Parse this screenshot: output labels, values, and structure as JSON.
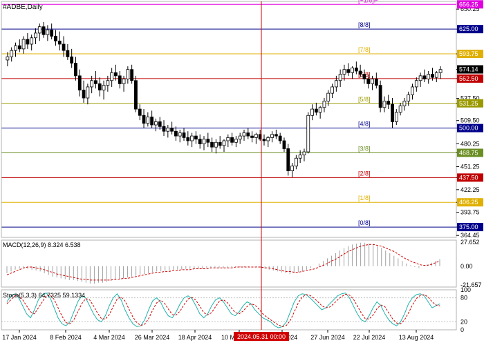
{
  "chart_data": {
    "type": "candlestick",
    "symbol_label": "#ADBE,Daily",
    "price_axis": {
      "min": 362,
      "max": 660,
      "ticks": [
        "650.25",
        "625.00",
        "593.75",
        "574.14",
        "562.50",
        "537.50",
        "531.25",
        "509.50",
        "500.00",
        "480.25",
        "468.75",
        "451.25",
        "437.50",
        "422.25",
        "406.25",
        "393.75",
        "375.00",
        "364.45"
      ]
    },
    "highlighted_prices": [
      {
        "value": "656.25",
        "color": "#e000e0",
        "text_color": "#ffffff"
      },
      {
        "value": "625.00",
        "color": "#00008b",
        "text_color": "#ffffff"
      },
      {
        "value": "593.75",
        "color": "#e0b000",
        "text_color": "#ffffff"
      },
      {
        "value": "574.14",
        "color": "#000000",
        "text_color": "#ffffff"
      },
      {
        "value": "562.50",
        "color": "#c00000",
        "text_color": "#ffffff"
      },
      {
        "value": "531.25",
        "color": "#9a9a00",
        "text_color": "#ffffff"
      },
      {
        "value": "500.00",
        "color": "#00008b",
        "text_color": "#ffffff"
      },
      {
        "value": "468.75",
        "color": "#6b8e23",
        "text_color": "#ffffff"
      },
      {
        "value": "437.50",
        "color": "#c00000",
        "text_color": "#ffffff"
      },
      {
        "value": "406.25",
        "color": "#e0b000",
        "text_color": "#ffffff"
      },
      {
        "value": "375.00",
        "color": "#00008b",
        "text_color": "#ffffff"
      }
    ],
    "murrey_levels": [
      {
        "label": "[+1/8]P",
        "value": 656.25,
        "color": "#e000e0"
      },
      {
        "label": "[8/8]",
        "value": 625.0,
        "color": "#00008b"
      },
      {
        "label": "[7/8]",
        "value": 593.75,
        "color": "#e0b000"
      },
      {
        "label": "[6/8]",
        "value": 562.5,
        "color": "#c00000"
      },
      {
        "label": "[5/8]",
        "value": 531.25,
        "color": "#9a9a00"
      },
      {
        "label": "[4/8]",
        "value": 500.0,
        "color": "#00008b"
      },
      {
        "label": "[3/8]",
        "value": 468.75,
        "color": "#6b8e23"
      },
      {
        "label": "[2/8]",
        "value": 437.5,
        "color": "#c00000"
      },
      {
        "label": "[1/8]",
        "value": 406.25,
        "color": "#e0b000"
      },
      {
        "label": "[0/8]",
        "value": 375.0,
        "color": "#00008b"
      }
    ],
    "dates": [
      "17 Jan 2024",
      "8 Feb 2024",
      "4 Mar 2024",
      "26 Mar 2024",
      "18 Apr 2024",
      "10 May 2024",
      "3 Jun 2024",
      "27 Jun 2024",
      "22 Jul 2024",
      "13 Aug 2024"
    ],
    "crosshair_date": "2024.05.31 00:00",
    "ohlc": [
      [
        586,
        596,
        578,
        590
      ],
      [
        590,
        602,
        584,
        598
      ],
      [
        598,
        608,
        590,
        604
      ],
      [
        604,
        612,
        596,
        600
      ],
      [
        600,
        616,
        594,
        612
      ],
      [
        612,
        620,
        600,
        606
      ],
      [
        606,
        618,
        598,
        614
      ],
      [
        614,
        626,
        606,
        620
      ],
      [
        620,
        632,
        610,
        628
      ],
      [
        628,
        634,
        614,
        618
      ],
      [
        618,
        630,
        610,
        624
      ],
      [
        624,
        632,
        612,
        616
      ],
      [
        616,
        624,
        604,
        610
      ],
      [
        610,
        622,
        598,
        606
      ],
      [
        606,
        616,
        590,
        598
      ],
      [
        598,
        606,
        586,
        590
      ],
      [
        590,
        600,
        576,
        582
      ],
      [
        582,
        590,
        560,
        566
      ],
      [
        566,
        574,
        540,
        548
      ],
      [
        548,
        560,
        532,
        538
      ],
      [
        538,
        556,
        530,
        552
      ],
      [
        552,
        566,
        544,
        560
      ],
      [
        560,
        572,
        550,
        556
      ],
      [
        556,
        564,
        540,
        548
      ],
      [
        548,
        560,
        536,
        554
      ],
      [
        554,
        566,
        546,
        560
      ],
      [
        560,
        576,
        552,
        570
      ],
      [
        570,
        580,
        560,
        566
      ],
      [
        566,
        572,
        550,
        556
      ],
      [
        556,
        566,
        546,
        562
      ],
      [
        562,
        578,
        556,
        574
      ],
      [
        574,
        580,
        556,
        560
      ],
      [
        560,
        566,
        520,
        524
      ],
      [
        524,
        530,
        510,
        516
      ],
      [
        516,
        524,
        500,
        506
      ],
      [
        506,
        520,
        502,
        514
      ],
      [
        514,
        522,
        500,
        504
      ],
      [
        504,
        512,
        496,
        508
      ],
      [
        508,
        514,
        498,
        502
      ],
      [
        502,
        510,
        490,
        496
      ],
      [
        496,
        504,
        488,
        500
      ],
      [
        500,
        508,
        492,
        496
      ],
      [
        496,
        502,
        484,
        490
      ],
      [
        490,
        498,
        482,
        494
      ],
      [
        494,
        500,
        484,
        488
      ],
      [
        488,
        496,
        478,
        484
      ],
      [
        484,
        494,
        476,
        490
      ],
      [
        490,
        496,
        480,
        486
      ],
      [
        486,
        492,
        474,
        480
      ],
      [
        480,
        490,
        472,
        486
      ],
      [
        486,
        494,
        476,
        482
      ],
      [
        482,
        488,
        470,
        476
      ],
      [
        476,
        486,
        468,
        482
      ],
      [
        482,
        490,
        474,
        478
      ],
      [
        478,
        486,
        470,
        484
      ],
      [
        484,
        492,
        476,
        488
      ],
      [
        488,
        494,
        478,
        482
      ],
      [
        482,
        490,
        476,
        486
      ],
      [
        486,
        494,
        480,
        490
      ],
      [
        490,
        498,
        484,
        494
      ],
      [
        494,
        500,
        486,
        490
      ],
      [
        490,
        496,
        482,
        488
      ],
      [
        488,
        494,
        480,
        492
      ],
      [
        492,
        498,
        484,
        486
      ],
      [
        486,
        492,
        478,
        484
      ],
      [
        484,
        490,
        476,
        488
      ],
      [
        488,
        496,
        482,
        492
      ],
      [
        492,
        498,
        486,
        490
      ],
      [
        490,
        494,
        480,
        484
      ],
      [
        484,
        488,
        470,
        474
      ],
      [
        474,
        480,
        440,
        446
      ],
      [
        446,
        456,
        438,
        452
      ],
      [
        452,
        466,
        448,
        462
      ],
      [
        462,
        472,
        456,
        466
      ],
      [
        466,
        474,
        458,
        470
      ],
      [
        470,
        520,
        468,
        516
      ],
      [
        516,
        530,
        510,
        524
      ],
      [
        524,
        532,
        516,
        520
      ],
      [
        520,
        528,
        512,
        526
      ],
      [
        526,
        538,
        520,
        534
      ],
      [
        534,
        548,
        528,
        544
      ],
      [
        544,
        556,
        538,
        552
      ],
      [
        552,
        566,
        546,
        560
      ],
      [
        560,
        574,
        552,
        568
      ],
      [
        568,
        580,
        560,
        574
      ],
      [
        574,
        582,
        566,
        570
      ],
      [
        570,
        578,
        562,
        576
      ],
      [
        576,
        584,
        568,
        572
      ],
      [
        572,
        580,
        564,
        568
      ],
      [
        568,
        574,
        556,
        562
      ],
      [
        562,
        568,
        550,
        556
      ],
      [
        556,
        566,
        548,
        562
      ],
      [
        562,
        570,
        550,
        554
      ],
      [
        554,
        560,
        520,
        526
      ],
      [
        526,
        540,
        520,
        534
      ],
      [
        534,
        542,
        524,
        530
      ],
      [
        530,
        538,
        500,
        508
      ],
      [
        508,
        524,
        504,
        520
      ],
      [
        520,
        532,
        516,
        528
      ],
      [
        528,
        538,
        522,
        534
      ],
      [
        534,
        546,
        528,
        542
      ],
      [
        542,
        556,
        536,
        552
      ],
      [
        552,
        564,
        546,
        560
      ],
      [
        560,
        570,
        552,
        566
      ],
      [
        566,
        574,
        558,
        562
      ],
      [
        562,
        572,
        556,
        568
      ],
      [
        568,
        576,
        560,
        564
      ],
      [
        564,
        572,
        558,
        570
      ],
      [
        570,
        578,
        562,
        574
      ]
    ],
    "macd": {
      "label": "MACD(12,26,9) 8.324 6.538",
      "ticks": [
        "27.652",
        "0.00",
        "-21.657"
      ],
      "range": [
        -24,
        30
      ],
      "hist": [
        -8,
        -6,
        -4,
        -3,
        -2,
        -3,
        -4,
        -5,
        -6,
        -8,
        -10,
        -12,
        -13,
        -14,
        -15,
        -16,
        -16,
        -17,
        -18,
        -19,
        -20,
        -20,
        -19,
        -19,
        -18,
        -17,
        -16,
        -15,
        -14,
        -13,
        -12,
        -11,
        -10,
        -9,
        -8,
        -7,
        -6,
        -6,
        -5,
        -5,
        -4,
        -4,
        -4,
        -3,
        -3,
        -3,
        -3,
        -3,
        -2,
        -2,
        -2,
        -2,
        -2,
        -2,
        -1,
        -1,
        -1,
        -1,
        -1,
        0,
        -1,
        -2,
        -3,
        -4,
        -5,
        -6,
        -7,
        -8,
        -9,
        -8,
        -7,
        -6,
        -4,
        -2,
        0,
        3,
        6,
        9,
        12,
        15,
        18,
        21,
        23,
        25,
        26,
        27,
        27,
        26,
        25,
        23,
        21,
        18,
        15,
        12,
        9,
        6,
        3,
        1,
        -1,
        -2,
        0,
        2,
        4,
        6,
        8
      ],
      "signal": [
        -10,
        -8,
        -6,
        -4,
        -2,
        -1,
        -1,
        -2,
        -3,
        -4,
        -6,
        -7,
        -9,
        -10,
        -11,
        -12,
        -13,
        -14,
        -15,
        -15,
        -16,
        -16,
        -16,
        -16,
        -16,
        -16,
        -15,
        -15,
        -14,
        -14,
        -13,
        -12,
        -11,
        -10,
        -9,
        -8,
        -7,
        -7,
        -6,
        -6,
        -5,
        -5,
        -4,
        -4,
        -4,
        -3,
        -3,
        -3,
        -3,
        -2,
        -2,
        -2,
        -2,
        -2,
        -2,
        -1,
        -1,
        -1,
        -1,
        -1,
        -1,
        -1,
        -2,
        -2,
        -3,
        -4,
        -5,
        -6,
        -6,
        -7,
        -7,
        -6,
        -5,
        -4,
        -3,
        -1,
        1,
        3,
        6,
        8,
        11,
        14,
        17,
        19,
        21,
        23,
        24,
        25,
        25,
        24,
        23,
        21,
        19,
        17,
        14,
        11,
        8,
        6,
        4,
        2,
        1,
        1,
        2,
        4,
        6
      ]
    },
    "stoch": {
      "label": "Stoch(5,3,3) 64.7325 59.1334",
      "ticks": [
        "100",
        "80",
        "20",
        "0"
      ],
      "main": [
        70,
        85,
        90,
        80,
        60,
        40,
        30,
        50,
        75,
        88,
        92,
        80,
        55,
        30,
        15,
        10,
        20,
        45,
        70,
        85,
        80,
        60,
        40,
        25,
        20,
        35,
        60,
        80,
        90,
        75,
        50,
        30,
        15,
        8,
        10,
        25,
        50,
        72,
        80,
        70,
        50,
        35,
        30,
        45,
        65,
        80,
        85,
        78,
        60,
        40,
        30,
        40,
        60,
        75,
        80,
        70,
        55,
        40,
        35,
        45,
        60,
        70,
        65,
        50,
        40,
        30,
        25,
        20,
        10,
        5,
        8,
        20,
        45,
        70,
        85,
        90,
        88,
        80,
        70,
        60,
        50,
        55,
        65,
        75,
        85,
        90,
        92,
        80,
        60,
        40,
        25,
        20,
        35,
        55,
        70,
        60,
        40,
        25,
        15,
        10,
        20,
        40,
        65,
        80,
        88,
        90,
        85,
        70,
        55,
        60,
        65
      ],
      "signal": [
        65,
        75,
        85,
        85,
        75,
        60,
        45,
        40,
        55,
        70,
        85,
        87,
        76,
        55,
        34,
        18,
        15,
        25,
        45,
        65,
        78,
        75,
        60,
        42,
        28,
        27,
        38,
        58,
        77,
        82,
        72,
        52,
        32,
        18,
        11,
        14,
        28,
        49,
        67,
        74,
        67,
        52,
        38,
        37,
        47,
        63,
        77,
        81,
        74,
        59,
        43,
        37,
        43,
        58,
        72,
        75,
        68,
        55,
        43,
        40,
        47,
        58,
        65,
        62,
        52,
        40,
        32,
        25,
        18,
        12,
        8,
        11,
        24,
        45,
        67,
        82,
        88,
        86,
        79,
        70,
        60,
        55,
        57,
        65,
        75,
        83,
        89,
        87,
        77,
        60,
        42,
        28,
        27,
        37,
        53,
        62,
        58,
        42,
        27,
        17,
        15,
        25,
        42,
        62,
        78,
        86,
        88,
        82,
        70,
        62,
        60
      ]
    }
  }
}
